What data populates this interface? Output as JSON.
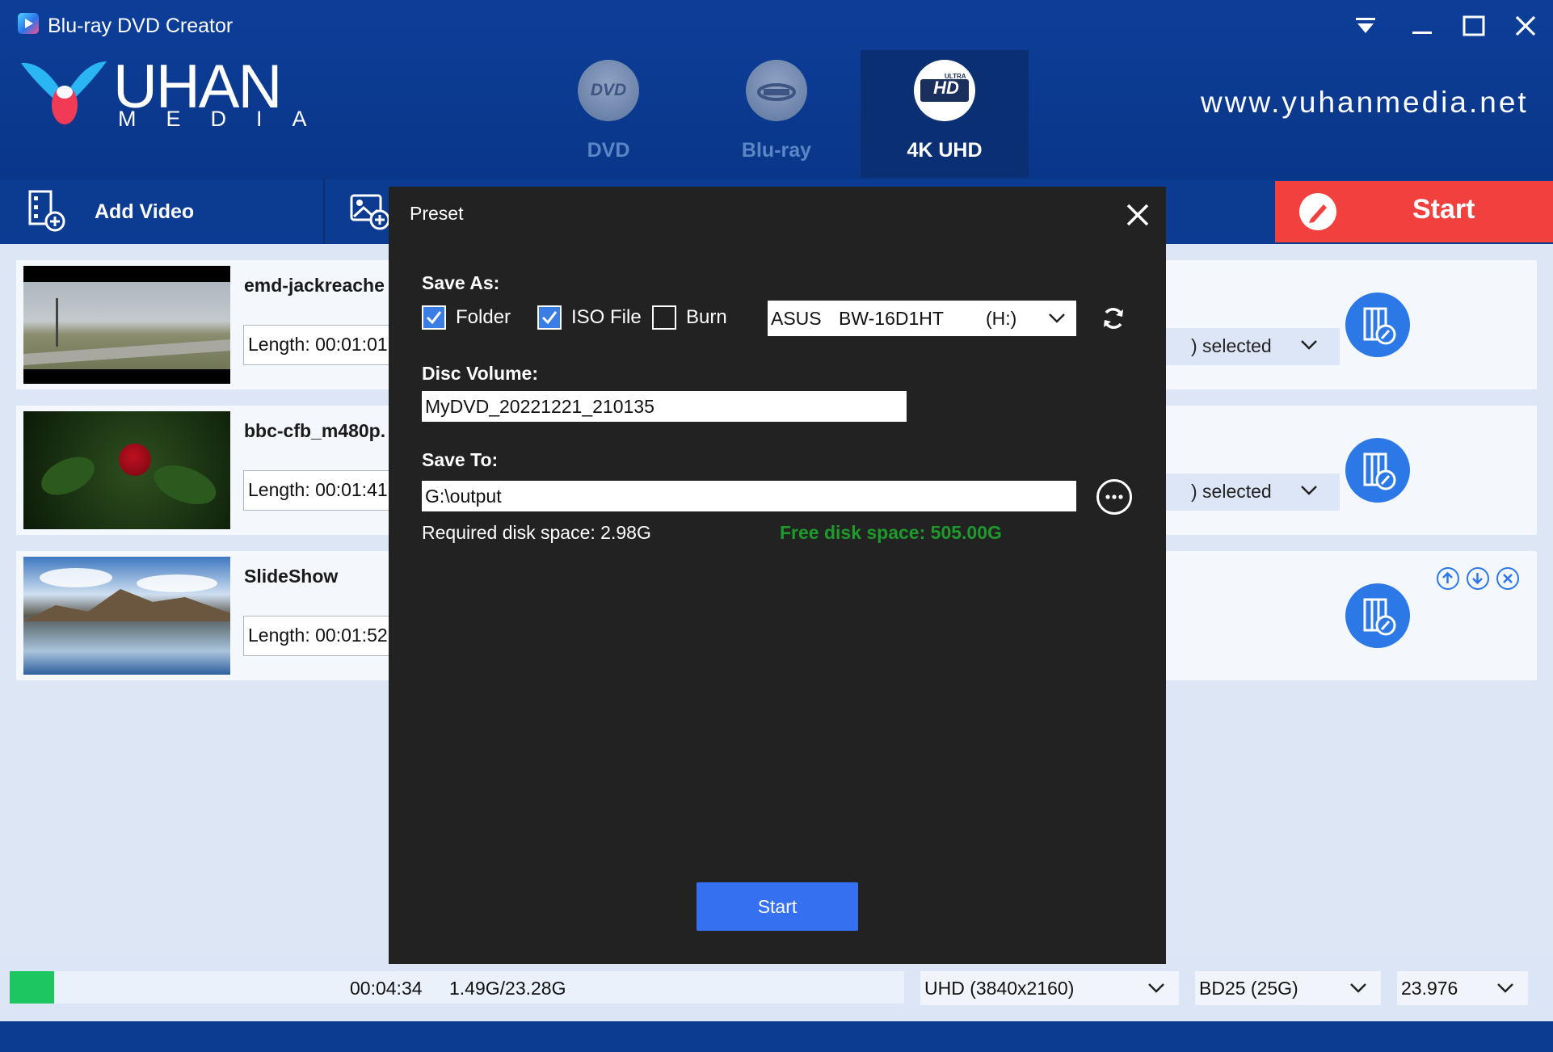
{
  "app": {
    "title": "Blu-ray DVD Creator",
    "logo_text": "UHAN",
    "logo_subtext": "MEDIA",
    "website": "www.yuhanmedia.net"
  },
  "disc_tabs": [
    {
      "label": "DVD",
      "icon": "dvd-disc-icon",
      "active": false
    },
    {
      "label": "Blu-ray",
      "icon": "bluray-disc-icon",
      "active": false
    },
    {
      "label": "4K UHD",
      "icon": "ultra-hd-disc-icon",
      "active": true
    }
  ],
  "toolbar": {
    "add_video_label": "Add Video",
    "start_label": "Start"
  },
  "videos": [
    {
      "name": "emd-jackreache",
      "length": "Length: 00:01:01",
      "select": ") selected"
    },
    {
      "name": "bbc-cfb_m480p.",
      "length": "Length: 00:01:41",
      "select": ") selected"
    },
    {
      "name": "SlideShow",
      "length": "Length: 00:01:52",
      "select": ""
    }
  ],
  "status": {
    "progress": 0.05,
    "time": "00:04:34",
    "size": "1.49G/23.28G",
    "resolution": "UHD (3840x2160)",
    "disc_type": "BD25 (25G)",
    "framerate": "23.976"
  },
  "preset": {
    "title": "Preset",
    "save_as_label": "Save As:",
    "folder_label": "Folder",
    "folder_checked": true,
    "iso_label": "ISO File",
    "iso_checked": true,
    "burn_label": "Burn",
    "burn_checked": false,
    "drive_brand": "ASUS",
    "drive_model": "BW-16D1HT",
    "drive_letter": "(H:)",
    "disc_volume_label": "Disc Volume:",
    "disc_volume_value": "MyDVD_20221221_210135",
    "save_to_label": "Save To:",
    "save_to_value": "G:\\output",
    "required_space": "Required disk space: 2.98G",
    "free_space": "Free disk space: 505.00G",
    "start_label": "Start"
  },
  "colors": {
    "header": "#0c3e99",
    "accent_blue": "#2c78e6",
    "start_red": "#f2403f",
    "progress_green": "#1ec65f",
    "modal_bg": "#222222",
    "free_space_green": "#1e9a2c"
  }
}
